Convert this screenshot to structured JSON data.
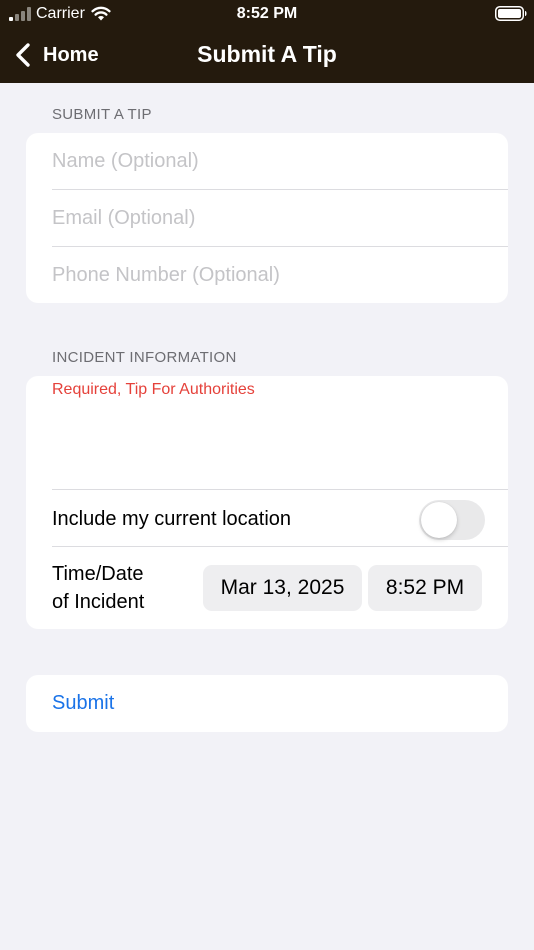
{
  "status_bar": {
    "carrier": "Carrier",
    "time": "8:52 PM"
  },
  "nav": {
    "back_label": "Home",
    "title": "Submit A Tip"
  },
  "contact_section": {
    "header": "SUBMIT A TIP",
    "name_placeholder": "Name (Optional)",
    "email_placeholder": "Email (Optional)",
    "phone_placeholder": "Phone Number (Optional)"
  },
  "incident_section": {
    "header": "INCIDENT INFORMATION",
    "tip_placeholder": "Required, Tip For Authorities",
    "location_label": "Include my current location",
    "location_enabled": false,
    "datetime_label_line1": "Time/Date",
    "datetime_label_line2": "of Incident",
    "date_value": "Mar 13, 2025",
    "time_value": "8:52 PM"
  },
  "submit": {
    "label": "Submit"
  },
  "colors": {
    "nav_background": "#241a0d",
    "page_background": "#f2f2f7",
    "placeholder_gray": "#c4c4c7",
    "required_red": "#e5413a",
    "link_blue": "#1a73e8",
    "toggle_off": "#e9e9ea"
  },
  "icons": {
    "signal": "cellular-signal-icon",
    "wifi": "wifi-icon",
    "battery": "battery-icon",
    "back": "chevron-left-icon"
  }
}
